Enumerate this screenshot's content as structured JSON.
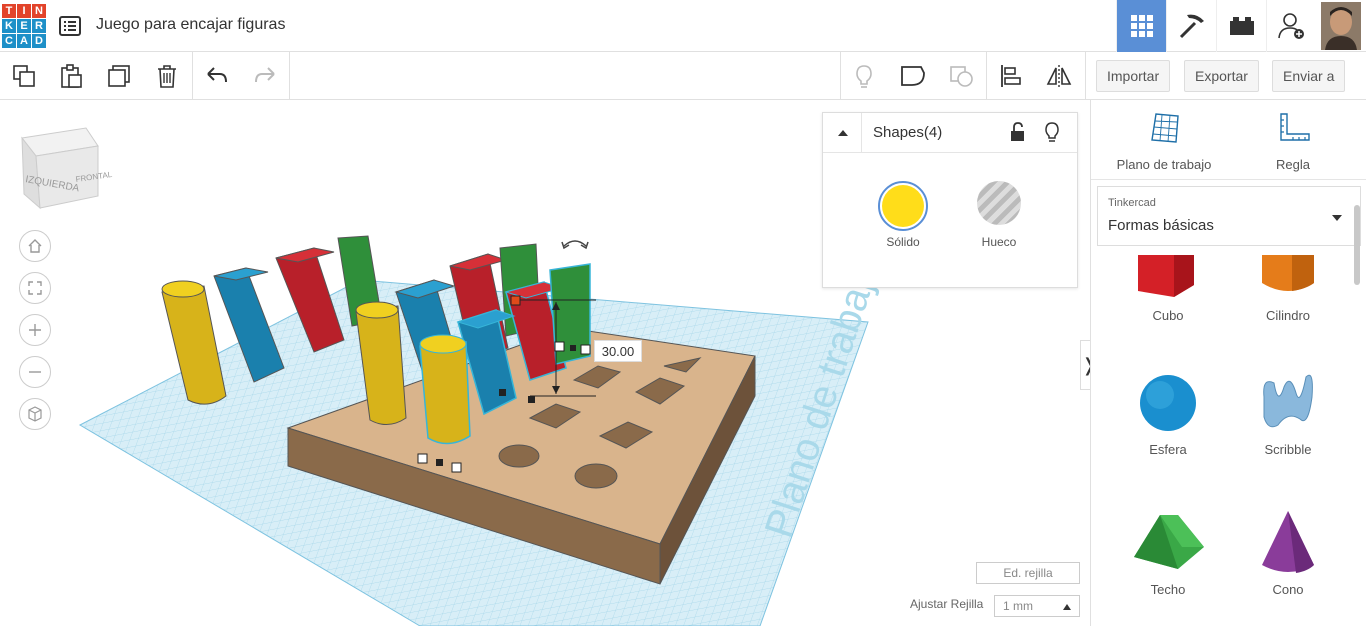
{
  "app": {
    "logo_letters": [
      "T",
      "I",
      "N",
      "K",
      "E",
      "R",
      "C",
      "A",
      "D"
    ],
    "logo_colors": [
      "#e2432a",
      "#e2432a",
      "#e2432a",
      "#1e90c8",
      "#1e90c8",
      "#1e90c8",
      "#1e90c8",
      "#1e90c8",
      "#1e90c8"
    ],
    "project_title": "Juego para encajar figuras"
  },
  "topbar": {
    "icons": [
      "grid-view-icon",
      "pickaxe-icon",
      "bricks-icon",
      "add-user-icon",
      "user-avatar"
    ]
  },
  "toolbar": {
    "import_label": "Importar",
    "export_label": "Exportar",
    "send_label": "Enviar a"
  },
  "viewcube": {
    "left_label": "IZQUIERDA",
    "front_label": "FRONTAL"
  },
  "shapes_panel": {
    "title": "Shapes(4)",
    "solid_label": "Sólido",
    "hole_label": "Hueco",
    "solid_color": "#ffdd1a"
  },
  "viewport": {
    "dimension_value": "30.00",
    "workplane_label": "Plano de trabajo",
    "grid_edit_label": "Ed. rejilla",
    "snap_label": "Ajustar Rejilla",
    "snap_value": "1 mm"
  },
  "right_panel": {
    "workplane_tool": "Plano de trabajo",
    "ruler_tool": "Regla",
    "library_source": "Tinkercad",
    "library_name": "Formas básicas",
    "shapes": [
      {
        "label": "Cubo",
        "color": "#d42027"
      },
      {
        "label": "Cilindro",
        "color": "#e57c1a"
      },
      {
        "label": "Esfera",
        "color": "#1a8fcf"
      },
      {
        "label": "Scribble",
        "color": "#8ab8dc"
      },
      {
        "label": "Techo",
        "color": "#3aa847"
      },
      {
        "label": "Cono",
        "color": "#8a3c9a"
      }
    ]
  }
}
